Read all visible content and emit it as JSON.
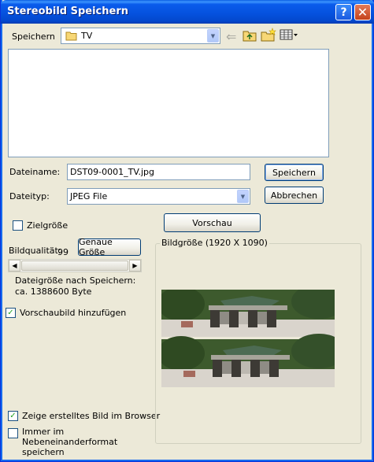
{
  "window": {
    "title": "Stereobild Speichern"
  },
  "save_in": {
    "label": "Speichern",
    "value": "TV"
  },
  "filename": {
    "label": "Dateiname:",
    "value": "DST09-0001_TV.jpg"
  },
  "filetype": {
    "label": "Dateityp:",
    "value": "JPEG File"
  },
  "buttons": {
    "save": "Speichern",
    "cancel": "Abbrechen",
    "preview": "Vorschau",
    "exact_size": "Genaue Größe"
  },
  "options": {
    "target_size": "Zielgröße",
    "quality_label": "Bildqualität:",
    "quality_value": "99",
    "filesize_line1": "Dateigröße nach Speichern:",
    "filesize_line2": "ca. 1388600 Byte",
    "add_thumbnail": "Vorschaubild hinzufügen",
    "show_in_browser": "Zeige erstelltes Bild im Browser",
    "side_by_side": "Immer im Nebeneinanderformat speichern"
  },
  "preview": {
    "size_label": "Bildgröße (1920 X 1090)"
  },
  "icons": [
    "help-icon",
    "close-icon",
    "folder-icon",
    "back-arrow-icon",
    "up-folder-icon",
    "new-folder-icon",
    "view-menu-icon"
  ]
}
